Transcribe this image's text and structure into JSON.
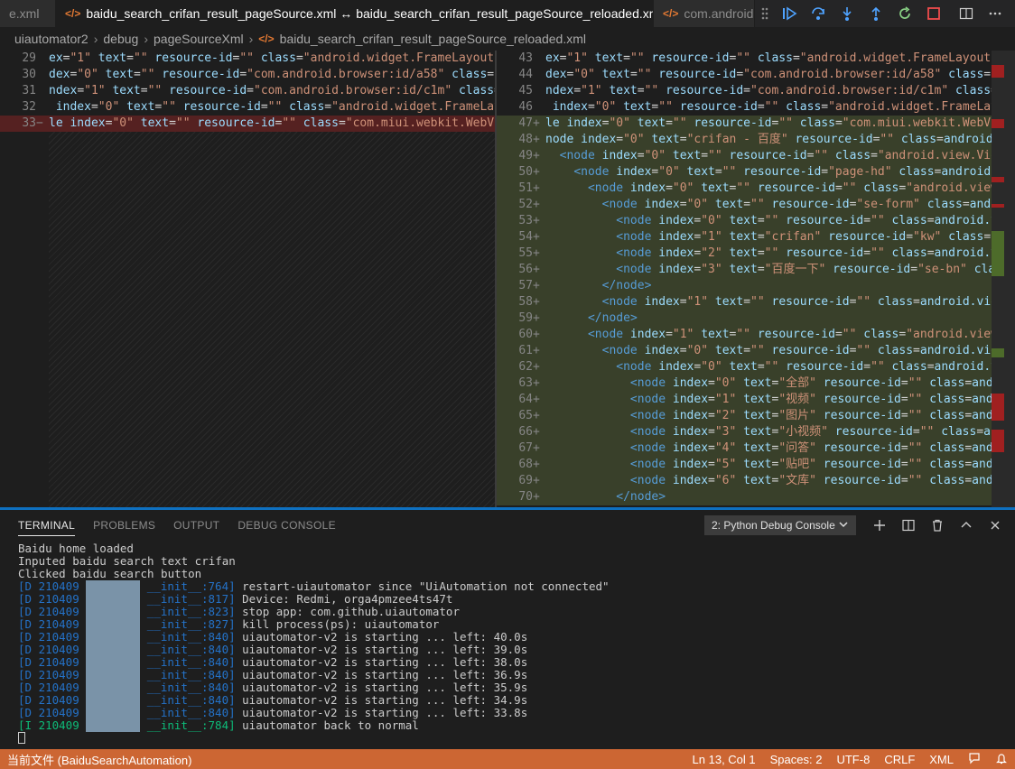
{
  "tabs": [
    {
      "label": "e.xml",
      "active": false
    },
    {
      "label": "baidu_search_crifan_result_pageSource.xml ↔ baidu_search_crifan_result_pageSource_reloaded.xml",
      "active": true
    },
    {
      "label": "com.android",
      "active": false
    }
  ],
  "tab_icon": "</>",
  "tab_close": "×",
  "debug_toolbar": [
    "drag-handle-icon",
    "continue-icon",
    "step-over-icon",
    "step-into-icon",
    "step-out-icon",
    "restart-icon",
    "stop-icon"
  ],
  "editor_actions": [
    "split-editor-icon",
    "more-icon"
  ],
  "breadcrumb": [
    "uiautomator2",
    "debug",
    "pageSourceXml",
    "baidu_search_crifan_result_pageSource_reloaded.xml"
  ],
  "left_lines": [
    {
      "n": "29",
      "mark": "",
      "kind": "normal",
      "code": "ex=\"1\" text=\"\" resource-id=\"\" class=\"android.widget.FrameLayout\" pack"
    },
    {
      "n": "30",
      "mark": "",
      "kind": "normal",
      "code": "dex=\"0\" text=\"\" resource-id=\"com.android.browser:id/a58\" class=\"andr"
    },
    {
      "n": "31",
      "mark": "",
      "kind": "normal",
      "code": "ndex=\"1\" text=\"\" resource-id=\"com.android.browser:id/c1m\" class=\"andr"
    },
    {
      "n": "32",
      "mark": "",
      "kind": "normal",
      "code": " index=\"0\" text=\"\" resource-id=\"\" class=\"android.widget.FrameLayout\""
    },
    {
      "n": "33",
      "mark": "−",
      "kind": "del",
      "code": "le index=\"0\" text=\"\" resource-id=\"\" class=\"com.miui.webkit.WebView\" p"
    }
  ],
  "right_lines": [
    {
      "n": "43",
      "mark": "",
      "kind": "normal",
      "code": "ex=\"1\" text=\"\" resource-id=\"\" class=\"android.widget.FrameLayout\" pack"
    },
    {
      "n": "44",
      "mark": "",
      "kind": "normal",
      "code": "dex=\"0\" text=\"\" resource-id=\"com.android.browser:id/a58\" class=\"andr"
    },
    {
      "n": "45",
      "mark": "",
      "kind": "normal",
      "code": "ndex=\"1\" text=\"\" resource-id=\"com.android.browser:id/c1m\" class=\"andr"
    },
    {
      "n": "46",
      "mark": "",
      "kind": "normal",
      "code": " index=\"0\" text=\"\" resource-id=\"\" class=\"android.widget.FrameLayout\""
    },
    {
      "n": "47",
      "mark": "+",
      "kind": "ins",
      "code": "le index=\"0\" text=\"\" resource-id=\"\" class=\"com.miui.webkit.WebView\" p"
    },
    {
      "n": "48",
      "mark": "+",
      "kind": "ins",
      "code": "node index=\"0\" text=\"crifan - 百度\" resource-id=\"\" class=\"android.webk"
    },
    {
      "n": "49",
      "mark": "+",
      "kind": "ins",
      "code": "  <node index=\"0\" text=\"\" resource-id=\"\" class=\"android.view.View\" pac"
    },
    {
      "n": "50",
      "mark": "+",
      "kind": "ins",
      "code": "    <node index=\"0\" text=\"\" resource-id=\"page-hd\" class=\"android.view."
    },
    {
      "n": "51",
      "mark": "+",
      "kind": "ins",
      "code": "      <node index=\"0\" text=\"\" resource-id=\"\" class=\"android.view.View\""
    },
    {
      "n": "52",
      "mark": "+",
      "kind": "ins",
      "code": "        <node index=\"0\" text=\"\" resource-id=\"se-form\" class=\"android.v"
    },
    {
      "n": "53",
      "mark": "+",
      "kind": "ins",
      "code": "          <node index=\"0\" text=\"\" resource-id=\"\" class=\"android.view.V"
    },
    {
      "n": "54",
      "mark": "+",
      "kind": "ins",
      "code": "          <node index=\"1\" text=\"crifan\" resource-id=\"kw\" class=\"androi"
    },
    {
      "n": "55",
      "mark": "+",
      "kind": "ins",
      "code": "          <node index=\"2\" text=\"\" resource-id=\"\" class=\"android.view.V"
    },
    {
      "n": "56",
      "mark": "+",
      "kind": "ins",
      "code": "          <node index=\"3\" text=\"百度一下\" resource-id=\"se-bn\" class=\"anc"
    },
    {
      "n": "57",
      "mark": "+",
      "kind": "ins",
      "code": "        </node>"
    },
    {
      "n": "58",
      "mark": "+",
      "kind": "ins",
      "code": "        <node index=\"1\" text=\"\" resource-id=\"\" class=\"android.view.Vie"
    },
    {
      "n": "59",
      "mark": "+",
      "kind": "ins",
      "code": "      </node>"
    },
    {
      "n": "60",
      "mark": "+",
      "kind": "ins",
      "code": "      <node index=\"1\" text=\"\" resource-id=\"\" class=\"android.view.View\""
    },
    {
      "n": "61",
      "mark": "+",
      "kind": "ins",
      "code": "        <node index=\"0\" text=\"\" resource-id=\"\" class=\"android.view.Vie"
    },
    {
      "n": "62",
      "mark": "+",
      "kind": "ins",
      "code": "          <node index=\"0\" text=\"\" resource-id=\"\" class=\"android.view.V"
    },
    {
      "n": "63",
      "mark": "+",
      "kind": "ins",
      "code": "            <node index=\"0\" text=\"全部\" resource-id=\"\" class=\"android.v"
    },
    {
      "n": "64",
      "mark": "+",
      "kind": "ins",
      "code": "            <node index=\"1\" text=\"视频\" resource-id=\"\" class=\"android.v"
    },
    {
      "n": "65",
      "mark": "+",
      "kind": "ins",
      "code": "            <node index=\"2\" text=\"图片\" resource-id=\"\" class=\"android.v"
    },
    {
      "n": "66",
      "mark": "+",
      "kind": "ins",
      "code": "            <node index=\"3\" text=\"小视频\" resource-id=\"\" class=\"android"
    },
    {
      "n": "67",
      "mark": "+",
      "kind": "ins",
      "code": "            <node index=\"4\" text=\"问答\" resource-id=\"\" class=\"android.v"
    },
    {
      "n": "68",
      "mark": "+",
      "kind": "ins",
      "code": "            <node index=\"5\" text=\"贴吧\" resource-id=\"\" class=\"android.v"
    },
    {
      "n": "69",
      "mark": "+",
      "kind": "ins",
      "code": "            <node index=\"6\" text=\"文库\" resource-id=\"\" class=\"android.v"
    },
    {
      "n": "70",
      "mark": "+",
      "kind": "ins",
      "code": "          </node>"
    }
  ],
  "panel": {
    "tabs": [
      "TERMINAL",
      "PROBLEMS",
      "OUTPUT",
      "DEBUG CONSOLE"
    ],
    "active_tab": "TERMINAL",
    "console_select": "2: Python Debug Console",
    "actions": [
      "add-icon",
      "split-terminal-icon",
      "trash-icon",
      "maximize-icon",
      "close-icon"
    ]
  },
  "terminal": {
    "plain_lines": [
      "Baidu home loaded",
      "Inputed baidu search text crifan",
      "Clicked baidu search button"
    ],
    "log_lines": [
      {
        "level": "[D 210409",
        "src": "__init__:764]",
        "msg": "restart-uiautomator since \"UiAutomation not connected\""
      },
      {
        "level": "[D 210409",
        "src": "__init__:817]",
        "msg": "Device: Redmi, orga4pmzee4ts47t"
      },
      {
        "level": "[D 210409",
        "src": "__init__:823]",
        "msg": "stop app: com.github.uiautomator"
      },
      {
        "level": "[D 210409",
        "src": "__init__:827]",
        "msg": "kill process(ps): uiautomator"
      },
      {
        "level": "[D 210409",
        "src": "__init__:840]",
        "msg": "uiautomator-v2 is starting ... left: 40.0s"
      },
      {
        "level": "[D 210409",
        "src": "__init__:840]",
        "msg": "uiautomator-v2 is starting ... left: 39.0s"
      },
      {
        "level": "[D 210409",
        "src": "__init__:840]",
        "msg": "uiautomator-v2 is starting ... left: 38.0s"
      },
      {
        "level": "[D 210409",
        "src": "__init__:840]",
        "msg": "uiautomator-v2 is starting ... left: 36.9s"
      },
      {
        "level": "[D 210409",
        "src": "__init__:840]",
        "msg": "uiautomator-v2 is starting ... left: 35.9s"
      },
      {
        "level": "[D 210409",
        "src": "__init__:840]",
        "msg": "uiautomator-v2 is starting ... left: 34.9s"
      },
      {
        "level": "[D 210409",
        "src": "__init__:840]",
        "msg": "uiautomator-v2 is starting ... left: 33.8s"
      },
      {
        "level": "[I 210409",
        "src": "__init__:784]",
        "msg": "uiautomator back to normal"
      }
    ]
  },
  "statusbar": {
    "left": "当前文件 (BaiduSearchAutomation)",
    "position": "Ln 13, Col 1",
    "spaces": "Spaces: 2",
    "encoding": "UTF-8",
    "eol": "CRLF",
    "language": "XML",
    "icons": [
      "feedback-icon",
      "bell-icon"
    ],
    "background": "#cc6633"
  },
  "colors": {
    "attr": "#9cdcfe",
    "string": "#ce9178",
    "tag": "#569cd6",
    "debug_icon": "#4fa3ff",
    "restart_icon": "#89d185",
    "stop_icon": "#f14c4c"
  }
}
